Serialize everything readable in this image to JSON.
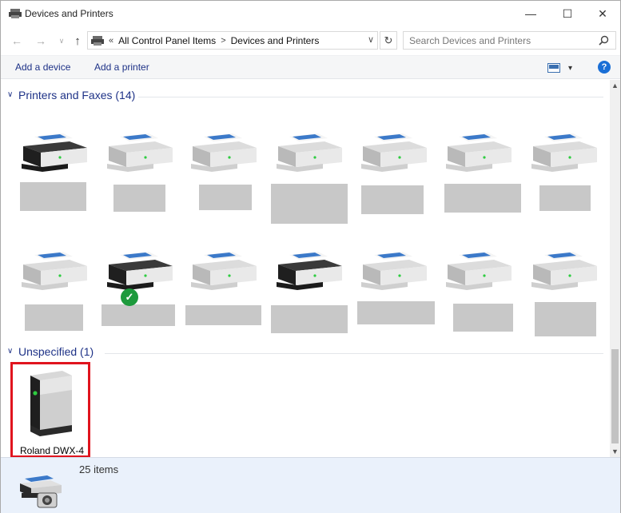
{
  "window": {
    "title": "Devices and Printers",
    "minimize_glyph": "—",
    "maximize_glyph": "☐",
    "close_glyph": "✕"
  },
  "nav": {
    "back_glyph": "←",
    "forward_glyph": "→",
    "recent_glyph": "∨",
    "up_glyph": "↑",
    "breadcrumb_prefix": "«",
    "breadcrumbs": [
      "All Control Panel Items",
      "Devices and Printers"
    ],
    "separator": ">",
    "dropdown_glyph": "∨",
    "refresh_glyph": "↻"
  },
  "search": {
    "placeholder": "Search Devices and Printers",
    "value": ""
  },
  "commands": {
    "add_device": "Add a device",
    "add_printer": "Add a printer",
    "view_dropdown_glyph": "▾",
    "help": "?"
  },
  "groups": {
    "printers": {
      "chevron": "∨",
      "title": "Printers and Faxes (14)",
      "items": [
        {
          "dark": true,
          "default": false
        },
        {
          "dark": false,
          "default": false
        },
        {
          "dark": false,
          "default": false
        },
        {
          "dark": false,
          "default": false
        },
        {
          "dark": false,
          "default": false
        },
        {
          "dark": false,
          "default": false
        },
        {
          "dark": false,
          "default": false
        },
        {
          "dark": false,
          "default": false
        },
        {
          "dark": true,
          "default": true
        },
        {
          "dark": false,
          "default": false
        },
        {
          "dark": true,
          "default": false
        },
        {
          "dark": false,
          "default": false
        },
        {
          "dark": false,
          "default": false
        },
        {
          "dark": false,
          "default": false
        }
      ],
      "default_check_glyph": "✓"
    },
    "unspecified": {
      "chevron": "∨",
      "title": "Unspecified (1)",
      "items": [
        {
          "label": "Roland DWX-4",
          "icon": "server-tower-icon"
        }
      ]
    }
  },
  "scrollbar": {
    "up_glyph": "▲",
    "down_glyph": "▼"
  },
  "details": {
    "count_text": "25 items"
  },
  "colors": {
    "accent_blue": "#1e3287",
    "highlight_red": "#e0141e",
    "check_green": "#1d9a3c",
    "details_bg": "#eaf1fb"
  }
}
